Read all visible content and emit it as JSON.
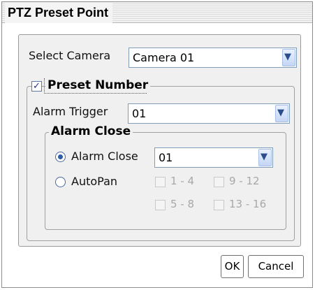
{
  "window": {
    "title": "PTZ Preset Point"
  },
  "select_camera": {
    "label": "Select Camera",
    "value": "Camera 01",
    "dropdown_icon": "chevron-down-icon"
  },
  "preset_number": {
    "label": "Preset Number",
    "checked": true,
    "check_glyph": "✓"
  },
  "alarm_trigger": {
    "label": "Alarm Trigger",
    "value": "01"
  },
  "alarm_close_group": {
    "legend": "Alarm Close",
    "alarm_close_option": {
      "label": "Alarm Close",
      "selected": true,
      "value": "01"
    },
    "autopan_option": {
      "label": "AutoPan",
      "selected": false,
      "ranges": [
        "1 - 4",
        "9 - 12",
        "5 - 8",
        "13 - 16"
      ]
    }
  },
  "buttons": {
    "ok": "OK",
    "cancel": "Cancel"
  }
}
